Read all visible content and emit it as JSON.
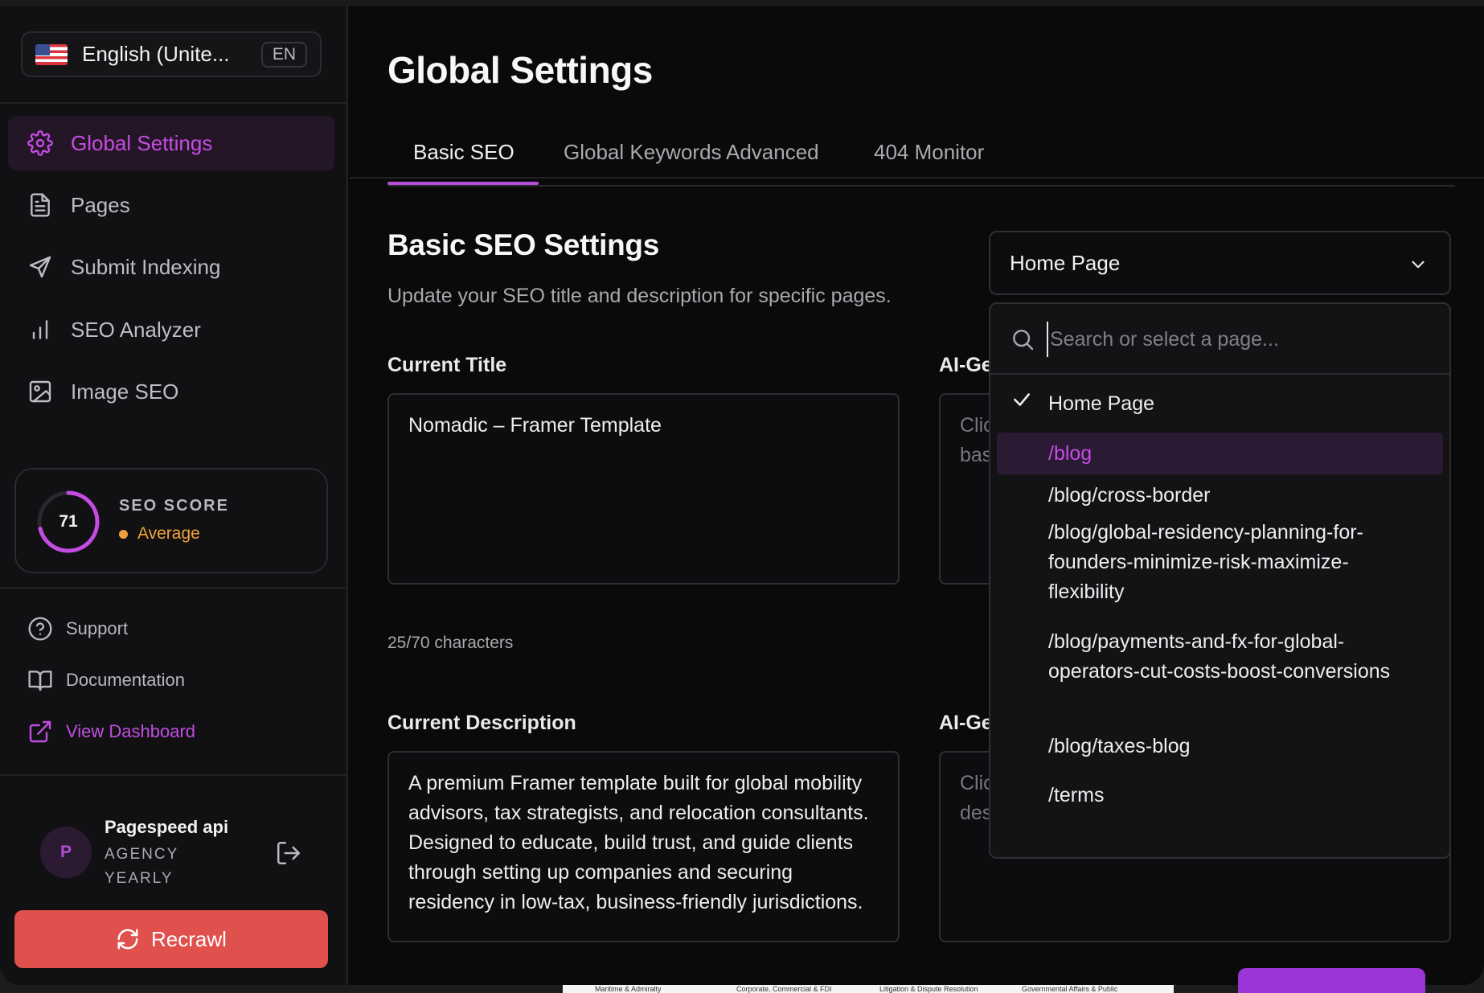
{
  "language": {
    "label": "English (Unite...",
    "code": "EN"
  },
  "sidebar": {
    "items": [
      {
        "label": "Global Settings",
        "icon": "gear-icon",
        "active": true
      },
      {
        "label": "Pages",
        "icon": "file-icon",
        "active": false
      },
      {
        "label": "Submit Indexing",
        "icon": "send-icon",
        "active": false
      },
      {
        "label": "SEO Analyzer",
        "icon": "bar-chart-icon",
        "active": false
      },
      {
        "label": "Image SEO",
        "icon": "image-icon",
        "active": false
      }
    ],
    "score": {
      "value": "71",
      "title": "SEO SCORE",
      "status": "Average",
      "fraction": 0.71
    },
    "links": [
      {
        "label": "Support",
        "icon": "help-circle-icon"
      },
      {
        "label": "Documentation",
        "icon": "book-icon"
      },
      {
        "label": "View Dashboard",
        "icon": "external-link-icon"
      }
    ],
    "user": {
      "initial": "P",
      "name": "Pagespeed api",
      "plan": "AGENCY YEARLY"
    },
    "recrawl_label": "Recrawl"
  },
  "main": {
    "title": "Global Settings",
    "tabs": [
      {
        "label": "Basic SEO",
        "active": true
      },
      {
        "label": "Global Keywords",
        "active": false
      },
      {
        "label": "Advanced",
        "active": false
      },
      {
        "label": "404 Monitor",
        "active": false
      }
    ],
    "section": {
      "title": "Basic SEO Settings",
      "subtitle": "Update your SEO title and description for specific pages."
    },
    "current_title": {
      "label": "Current Title",
      "value": "Nomadic – Framer Template",
      "char_count": "25/70 characters"
    },
    "ai_title": {
      "label": "AI-Ge",
      "placeholder": "Clic\nbas"
    },
    "current_description": {
      "label": "Current Description",
      "value": "A premium Framer template built for global mobility advisors, tax strategists, and relocation consultants. Designed to educate, build trust, and guide clients through setting up companies and securing residency in low-tax, business-friendly jurisdictions."
    },
    "ai_description": {
      "label": "AI-Ge",
      "placeholder": "Clic\ndes"
    },
    "page_select": {
      "selected": "Home Page",
      "search_placeholder": "Search or select a page...",
      "options": [
        "Home Page",
        "/blog",
        "/blog/cross-border",
        "/blog/global-residency-planning-for-founders-minimize-risk-maximize-flexibility",
        "/blog/payments-and-fx-for-global-operators-cut-costs-boost-conversions",
        "/blog/taxes-blog",
        "/terms"
      ],
      "highlighted": "/blog"
    }
  },
  "background_strip": [
    "Maritime & Admiralty",
    "Corporate, Commercial & FDI",
    "Litigation & Dispute Resolution",
    "Governmental Affairs & Public"
  ],
  "colors": {
    "accent": "#c54ce3",
    "recrawl": "#e0504c",
    "average": "#f0a23a"
  }
}
